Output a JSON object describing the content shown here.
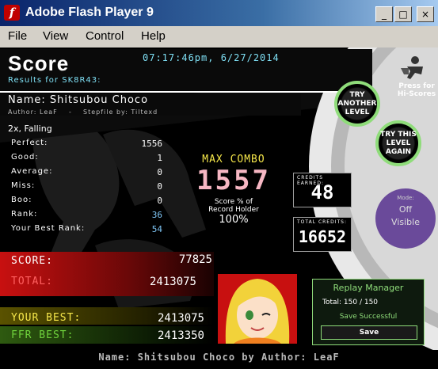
{
  "window": {
    "title": "Adobe Flash Player 9",
    "buttons": [
      "_",
      "□",
      "×"
    ]
  },
  "menu": [
    "File",
    "View",
    "Control",
    "Help"
  ],
  "header": {
    "heading": "Score",
    "timestamp": "07:17:46pm, 6/27/2014",
    "results_for": "Results for SK8R43:",
    "press_for": "Press for",
    "hi_scores": "Hi-Scores"
  },
  "song": {
    "name_line": "Name: Shitsubou Choco",
    "author_line": "Author: LeaF    -    Stepfile by: Tiltexd",
    "mods": "2x, Falling"
  },
  "stats": [
    {
      "label": "Perfect:",
      "value": "1556"
    },
    {
      "label": "Good:",
      "value": "1"
    },
    {
      "label": "Average:",
      "value": "0"
    },
    {
      "label": "Miss:",
      "value": "0"
    },
    {
      "label": "Boo:",
      "value": "0"
    },
    {
      "label": "Rank:",
      "value": "36"
    },
    {
      "label": "Your Best Rank:",
      "value": "54"
    }
  ],
  "combo": {
    "label": "MAX COMBO",
    "value": "1557",
    "record_line1": "Score % of",
    "record_line2": "Record Holder",
    "record_pct": "100%"
  },
  "credits": {
    "earned_label": "CREDITS EARNED:",
    "earned": "48",
    "total_label": "TOTAL CREDITS:",
    "total": "16652"
  },
  "mode": {
    "label": "Mode:",
    "off": "Off",
    "visible": "Visible"
  },
  "buttons": {
    "try_another": "TRY ANOTHER LEVEL",
    "try_again": "TRY THIS LEVEL AGAIN"
  },
  "scores": [
    {
      "label": "SCORE:",
      "value": "77825"
    },
    {
      "label": "TOTAL:",
      "value": "2413075"
    },
    {
      "label": "YOUR BEST:",
      "value": "2413075"
    },
    {
      "label": "FFR BEST:",
      "value": "2413350"
    }
  ],
  "replay": {
    "title": "Replay Manager",
    "total": "Total: 150 / 150",
    "status": "Save Successful",
    "save": "Save"
  },
  "footer": "Name: Shitsubou Choco by Author: LeaF",
  "colors": {
    "title_bg": "#0a246a",
    "neon_green": "#8fdc7a",
    "score_red": "#c81010",
    "best_yellow": "#f5e64a",
    "ffr_green": "#6fd23c",
    "purple": "#6a4a9a"
  }
}
